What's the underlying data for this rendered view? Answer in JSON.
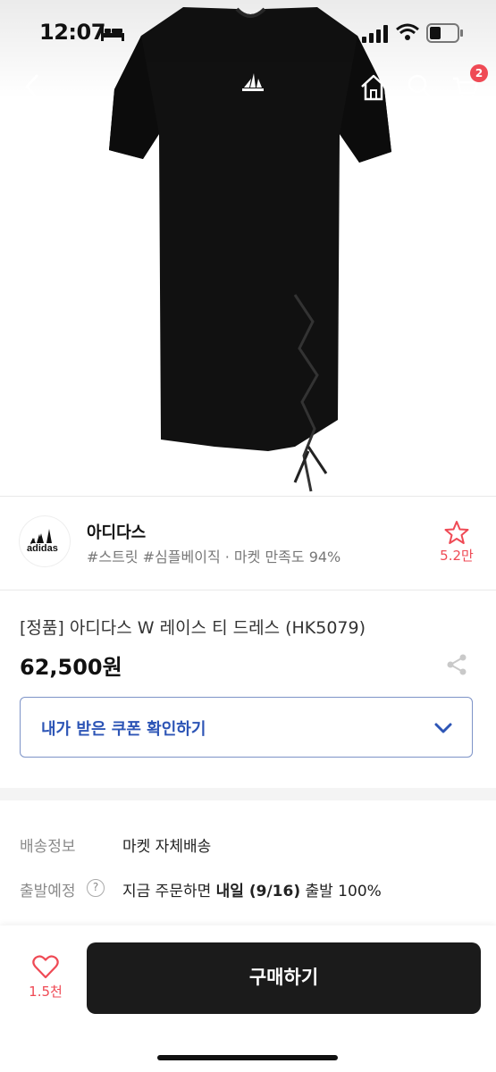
{
  "status_bar": {
    "time": "12:07",
    "icons": [
      "bed-icon",
      "signal-icon",
      "wifi-icon",
      "battery-icon"
    ]
  },
  "nav": {
    "icons": [
      "back-icon",
      "home-icon",
      "search-icon",
      "cart-icon"
    ],
    "cart_badge": "2"
  },
  "hero": {
    "image": "black adidas t-shirt dress with lace-up side"
  },
  "brand": {
    "logo": "adidas",
    "name": "아디다스",
    "tags": "#스트릿 #심플베이직 · 마켓 만족도 94%",
    "fav_count": "5.2만"
  },
  "product": {
    "title": "[정품] 아디다스 W 레이스 티 드레스 (HK5079)",
    "price": "62,500원"
  },
  "coupon": {
    "label": "내가 받은 쿠폰 확인하기"
  },
  "shipping": {
    "key1": "배송정보",
    "val1": "마켓 자체배송",
    "key2": "출발예정",
    "help": "?",
    "val2_prefix": "지금 주문하면",
    "val2_bold": "내일 (9/16)",
    "val2_suffix": "출발 100%"
  },
  "bottom": {
    "like_count": "1.5천",
    "buy_label": "구매하기"
  },
  "colors": {
    "accent_red": "#ef4a55",
    "coupon_blue": "#2d55b6",
    "buy_black": "#1b1b1b"
  }
}
